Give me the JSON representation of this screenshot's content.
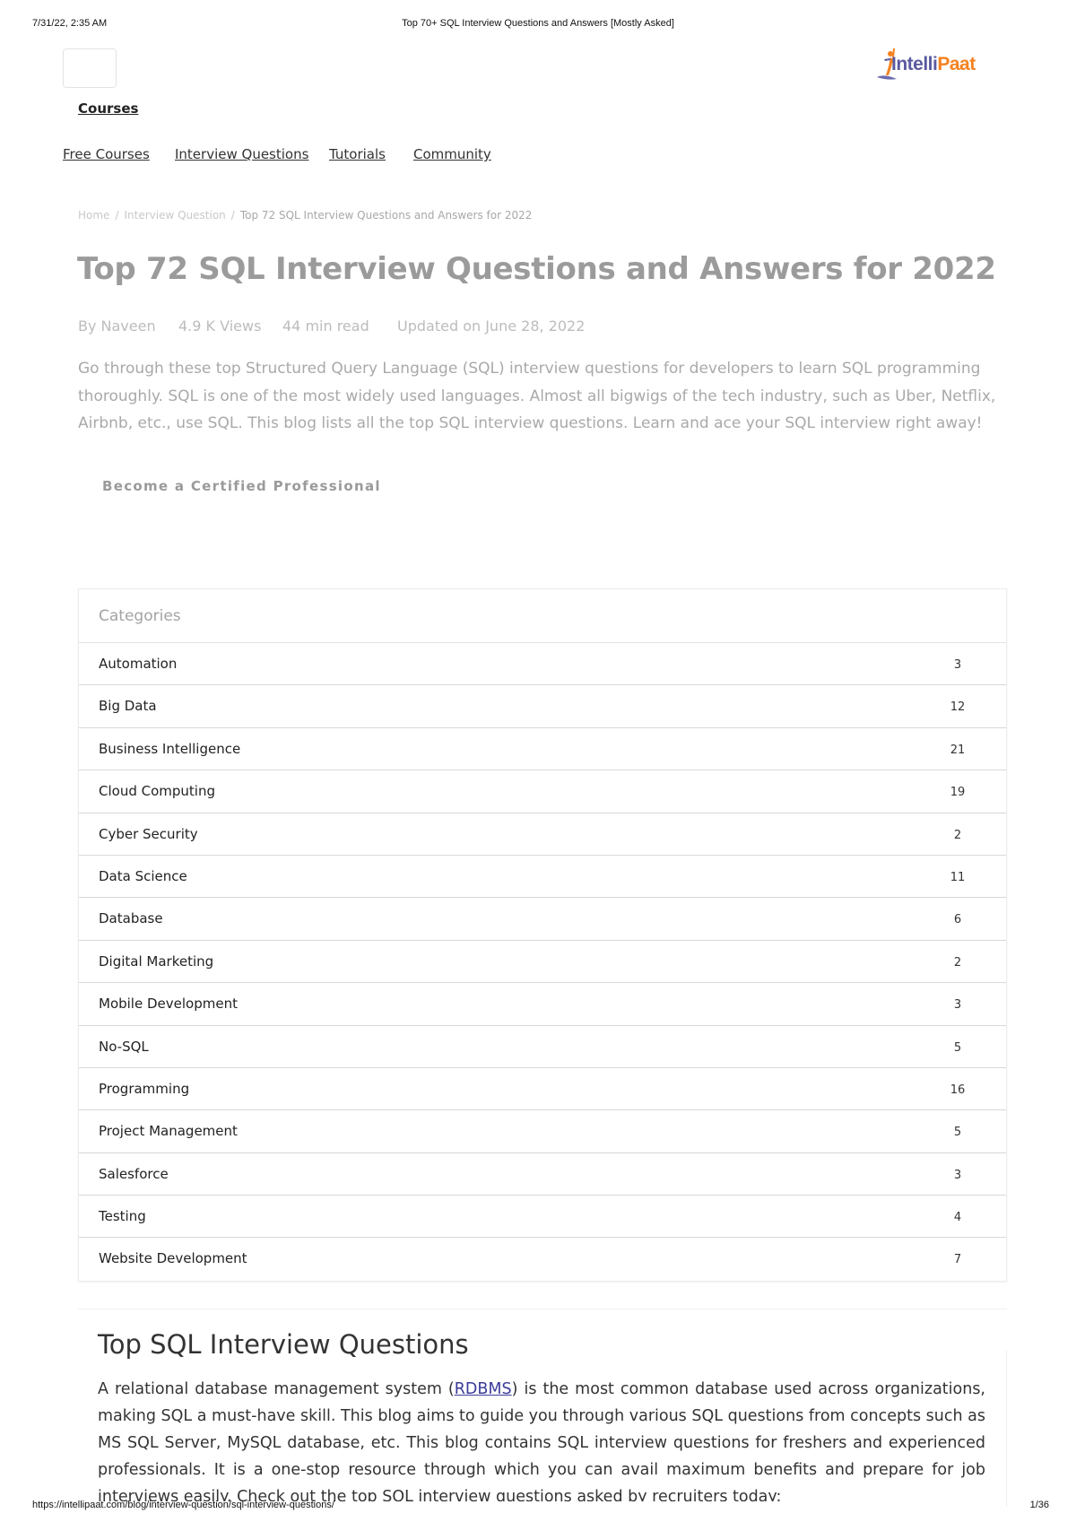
{
  "print_header": {
    "datetime": "7/31/22, 2:35 AM",
    "document_title": "Top 70+ SQL Interview Questions and Answers [Mostly Asked]"
  },
  "print_footer": {
    "url": "https://intellipaat.com/blog/interview-question/sql-interview-questions/",
    "page": "1/36"
  },
  "header": {
    "logo": {
      "part1": "Intelli",
      "part2": "Paat",
      "icon": "intellipaat-logo-icon"
    },
    "menu_icon": "menu-box-icon",
    "courses_label": "Courses"
  },
  "nav": {
    "items": [
      {
        "label": "Free Courses"
      },
      {
        "label": "Interview Questions"
      },
      {
        "label": "Tutorials"
      },
      {
        "label": "Community"
      }
    ]
  },
  "breadcrumb": {
    "items": [
      "Home",
      "Interview Question",
      "Top 72 SQL Interview Questions and Answers for 2022"
    ],
    "separator": "/"
  },
  "article": {
    "title": "Top 72 SQL Interview Questions and Answers for 2022",
    "author": "By Naveen",
    "views": "4.9 K Views",
    "read_time": "44  min read",
    "updated": "Updated on June 28, 2022",
    "intro": "Go through these top Structured Query Language (SQL) interview questions for developers to learn SQL programming thoroughly. SQL is one of the most widely used languages. Almost all bigwigs of the tech industry, such as Uber, Netflix, Airbnb, etc., use SQL. This blog lists all the top SQL interview questions. Learn and ace your SQL interview right away!",
    "cta": "Become a Certified Professional"
  },
  "categories": {
    "heading": "Categories",
    "items": [
      {
        "name": "Automation",
        "count": "3"
      },
      {
        "name": "Big Data",
        "count": "12"
      },
      {
        "name": "Business Intelligence",
        "count": "21"
      },
      {
        "name": "Cloud Computing",
        "count": "19"
      },
      {
        "name": "Cyber Security",
        "count": "2"
      },
      {
        "name": "Data Science",
        "count": "11"
      },
      {
        "name": "Database",
        "count": "6"
      },
      {
        "name": "Digital Marketing",
        "count": "2"
      },
      {
        "name": "Mobile Development",
        "count": "3"
      },
      {
        "name": "No-SQL",
        "count": "5"
      },
      {
        "name": "Programming",
        "count": "16"
      },
      {
        "name": "Project Management",
        "count": "5"
      },
      {
        "name": "Salesforce",
        "count": "3"
      },
      {
        "name": "Testing",
        "count": "4"
      },
      {
        "name": "Website Development",
        "count": "7"
      }
    ]
  },
  "section": {
    "title": "Top SQL Interview Questions",
    "body_before_link": "A relational database management system (",
    "link_text": "RDBMS",
    "body_after_link": ") is the most common database used across organizations, making SQL a must-have skill. This blog aims to guide you through various SQL questions from concepts such as MS SQL Server, MySQL database, etc. This blog contains SQL interview questions for freshers and experienced professionals. It is a one-stop resource through which you can avail maximum benefits and prepare for job interviews easily. Check out the top SQL interview questions asked by recruiters today:"
  },
  "colors": {
    "brand_purple": "#5a5aa0",
    "brand_orange": "#f58220",
    "link": "#3b3b9b"
  }
}
